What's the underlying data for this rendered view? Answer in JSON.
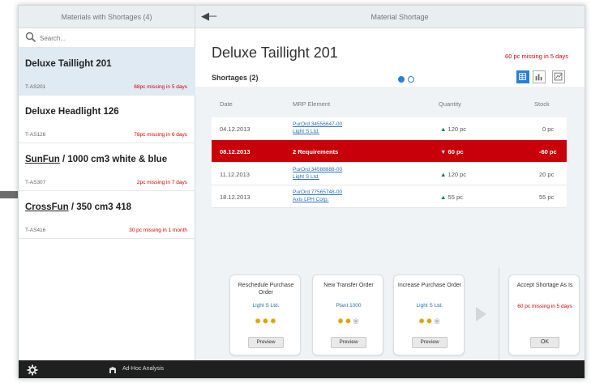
{
  "header": {
    "master_title": "Materials with Shortages (4)",
    "detail_title": "Material Shortage"
  },
  "search": {
    "placeholder": "Search..."
  },
  "materials": [
    {
      "title": "Deluxe Taillight 201",
      "id": "T-AS201",
      "status": "68pc missing in 5 days"
    },
    {
      "title": "Deluxe Headlight 126",
      "id": "T-AS126",
      "status": "78pc missing in 6 days"
    },
    {
      "title_link": "SunFun",
      "title_rest": " / 1000 cm3 white & blue",
      "id": "T-AS307",
      "status": "2pc missing in 7 days"
    },
    {
      "title_link": "CrossFun",
      "title_rest": " / 350 cm3 418",
      "id": "T-AS416",
      "status": "30 pc missing in 1 month"
    }
  ],
  "detail": {
    "title": "Deluxe Taillight 201",
    "status": "60 pc missing in 5 days",
    "shortages_label": "Shortages (2)"
  },
  "table": {
    "headers": {
      "date": "Date",
      "mrp": "MRP Element",
      "quantity": "Quantity",
      "stock": "Stock"
    },
    "rows": [
      {
        "date": "04.12.2013",
        "mrp1": "PurOrd 34556647-00",
        "mrp2": "Light S Ltd.",
        "qty": "120 pc",
        "stock": "0 pc"
      },
      {
        "date": "08.12.2013",
        "mrp1": "2 Requirements",
        "qty": "60 pc",
        "stock": "-60 pc"
      },
      {
        "date": "11.12.2013",
        "mrp1": "PurOrd 34588888-00",
        "mrp2": "Light S Ltd.",
        "qty": "120 pc",
        "stock": "20 pc"
      },
      {
        "date": "18.12.2013",
        "mrp1": "PurOrd 77565748-00",
        "mrp2": "Axis LPH Corp.",
        "qty": "55 pc",
        "stock": "55 pc"
      }
    ]
  },
  "solutions": [
    {
      "title": "Reschedule Purchase Order",
      "link": "Light S Ltd.",
      "rating": 3,
      "button": "Preview"
    },
    {
      "title": "New Transfer Order",
      "link": "Plant 1000",
      "rating": 2,
      "button": "Preview"
    },
    {
      "title": "Increase Purchase Order",
      "link": "Light S Ltd.",
      "rating": 2,
      "button": "Preview"
    }
  ],
  "accept": {
    "title": "Accept Shortage As Is",
    "status": "60 pc missing in 5 days",
    "button": "OK"
  },
  "footer": {
    "adhoc_label": "Ad-Hoc Analysis"
  },
  "colors": {
    "accent": "#2a7fd4",
    "alert": "#c8000a",
    "positive": "#0a7f3f",
    "star": "#d9a300"
  }
}
